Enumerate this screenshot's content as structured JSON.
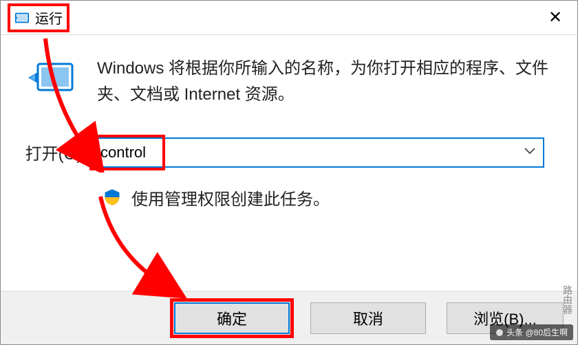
{
  "titlebar": {
    "title": "运行",
    "close_label": "✕"
  },
  "description": "Windows 将根据你所输入的名称，为你打开相应的程序、文件夹、文档或 Internet 资源。",
  "open_label": "打开(O):",
  "input_value": "control",
  "admin_note": "使用管理权限创建此任务。",
  "buttons": {
    "ok": "确定",
    "cancel": "取消",
    "browse": "浏览(B)..."
  },
  "watermark": {
    "main": "头条 @80后生啊",
    "side": "路由器"
  },
  "colors": {
    "highlight": "#ff0000",
    "focus_border": "#0078d7"
  }
}
